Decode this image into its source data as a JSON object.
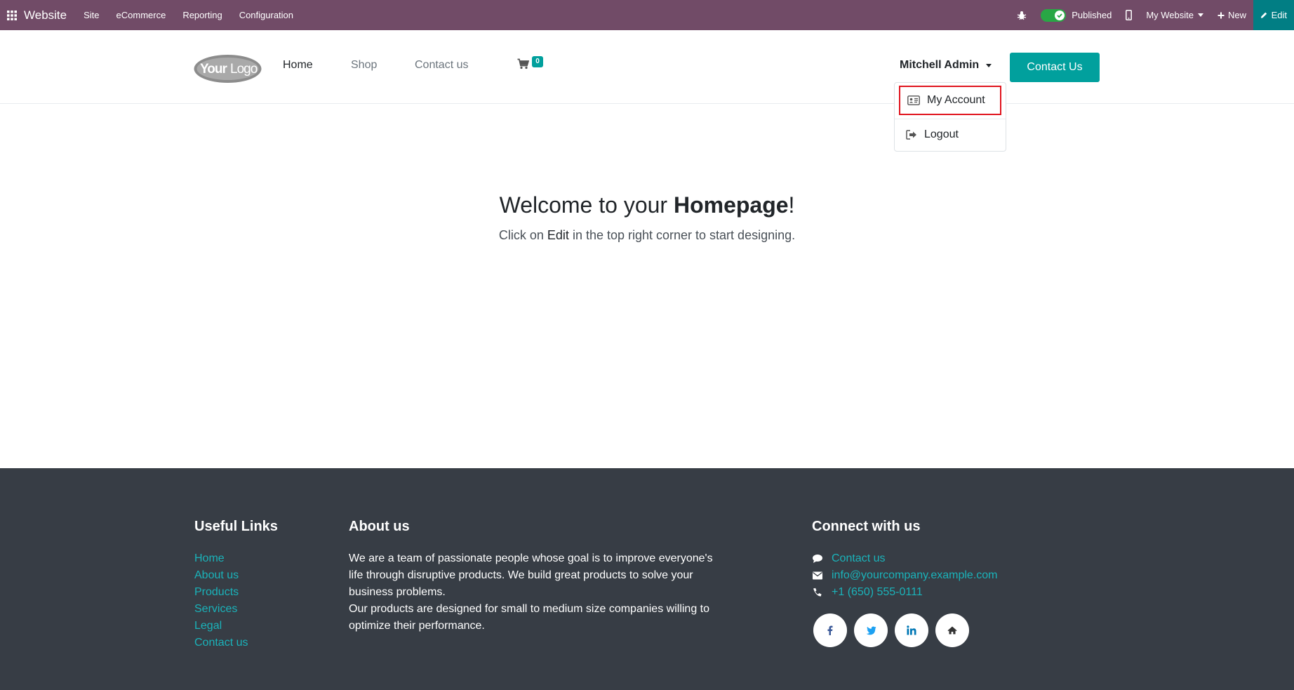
{
  "topbar": {
    "brand": "Website",
    "menu": [
      "Site",
      "eCommerce",
      "Reporting",
      "Configuration"
    ],
    "published_label": "Published",
    "website_label": "My Website",
    "new_label": "New",
    "edit_label": "Edit"
  },
  "header": {
    "nav": [
      "Home",
      "Shop",
      "Contact us"
    ],
    "cart_count": "0",
    "user_name": "Mitchell Admin",
    "contact_button": "Contact Us"
  },
  "dropdown": {
    "items": [
      "My Account",
      "Logout"
    ]
  },
  "hero": {
    "title_prefix": "Welcome to your ",
    "title_bold": "Homepage",
    "title_suffix": "!",
    "sub_prefix": "Click on ",
    "sub_em": "Edit",
    "sub_suffix": " in the top right corner to start designing."
  },
  "footer": {
    "useful_links_title": "Useful Links",
    "useful_links": [
      "Home",
      "About us",
      "Products",
      "Services",
      "Legal",
      "Contact us"
    ],
    "about_title": "About us",
    "about_p1": "We are a team of passionate people whose goal is to improve everyone's life through disruptive products. We build great products to solve your business problems.",
    "about_p2": "Our products are designed for small to medium size companies willing to optimize their performance.",
    "connect_title": "Connect with us",
    "contact_link": "Contact us",
    "email": "info@yourcompany.example.com",
    "phone": "+1 (650) 555-0111"
  },
  "colors": {
    "topbar": "#714b67",
    "accent": "#01a09d",
    "footer_bg": "#373d45",
    "link": "#1ab3ba",
    "highlight": "#e0141e"
  }
}
